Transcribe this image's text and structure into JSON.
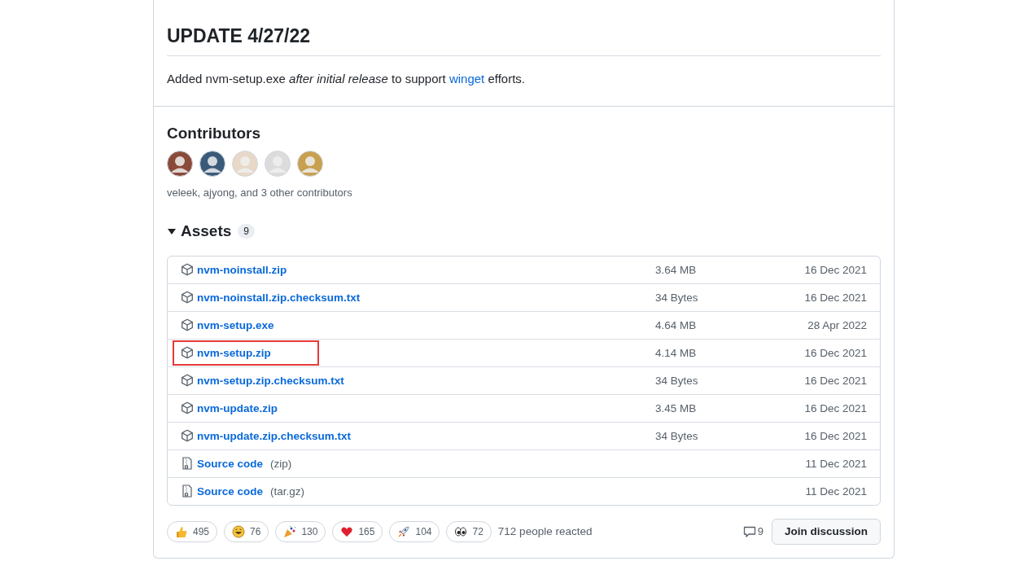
{
  "update": {
    "heading": "UPDATE 4/27/22",
    "text": "Added nvm-setup.exe *after initial release* to support ",
    "link": "winget",
    "text_after": " efforts."
  },
  "contributors": {
    "heading": "Contributors",
    "avatars": [
      {
        "color": "#8a4a3a"
      },
      {
        "color": "#3a5a7a"
      },
      {
        "color": "#e8d8c8"
      },
      {
        "color": "#dcdcdc"
      },
      {
        "color": "#c8a050"
      }
    ],
    "summary": "veleek, ajyong, and 3 other contributors"
  },
  "assets": {
    "heading": "Assets",
    "count": "9",
    "expanded": true,
    "rows": [
      {
        "kind": "package",
        "name": "nvm-noinstall.zip",
        "size": "3.64 MB",
        "date": "16 Dec 2021",
        "highlighted": false
      },
      {
        "kind": "package",
        "name": "nvm-noinstall.zip.checksum.txt",
        "size": "34 Bytes",
        "date": "16 Dec 2021",
        "highlighted": false
      },
      {
        "kind": "package",
        "name": "nvm-setup.exe",
        "size": "4.64 MB",
        "date": "28 Apr 2022",
        "highlighted": false
      },
      {
        "kind": "package",
        "name": "nvm-setup.zip",
        "size": "4.14 MB",
        "date": "16 Dec 2021",
        "highlighted": true
      },
      {
        "kind": "package",
        "name": "nvm-setup.zip.checksum.txt",
        "size": "34 Bytes",
        "date": "16 Dec 2021",
        "highlighted": false
      },
      {
        "kind": "package",
        "name": "nvm-update.zip",
        "size": "3.45 MB",
        "date": "16 Dec 2021",
        "highlighted": false
      },
      {
        "kind": "package",
        "name": "nvm-update.zip.checksum.txt",
        "size": "34 Bytes",
        "date": "16 Dec 2021",
        "highlighted": false
      },
      {
        "kind": "source",
        "name": "Source code",
        "format": "(zip)",
        "date": "11 Dec 2021",
        "highlighted": false
      },
      {
        "kind": "source",
        "name": "Source code",
        "format": "(tar.gz)",
        "date": "11 Dec 2021",
        "highlighted": false
      }
    ]
  },
  "reactions": {
    "items": [
      {
        "kind": "thumbs_up",
        "count": "495"
      },
      {
        "kind": "laugh",
        "count": "76"
      },
      {
        "kind": "hooray",
        "count": "130"
      },
      {
        "kind": "heart",
        "count": "165"
      },
      {
        "kind": "rocket",
        "count": "104"
      },
      {
        "kind": "eyes",
        "count": "72"
      }
    ],
    "summary": "712 people reacted",
    "comments": "9",
    "button": "Join discussion"
  }
}
